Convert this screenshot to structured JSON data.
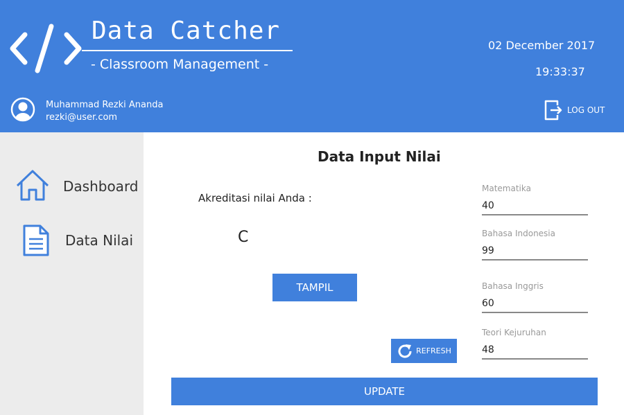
{
  "header": {
    "app_title": "Data Catcher",
    "app_subtitle": "- Classroom Management -",
    "date": "02 December 2017",
    "time": "19:33:37",
    "user_name": "Muhammad Rezki Ananda",
    "user_email": "rezki@user.com",
    "logout_label": "LOG OUT",
    "background_color": "#4080dc"
  },
  "sidebar": {
    "items": [
      {
        "label": "Dashboard",
        "icon": "home-icon"
      },
      {
        "label": "Data Nilai",
        "icon": "document-icon"
      }
    ]
  },
  "main": {
    "title": "Data Input Nilai",
    "akreditasi_label": "Akreditasi nilai Anda :",
    "grade": "C",
    "tampil_label": "TAMPIL",
    "refresh_label": "REFRESH",
    "update_label": "UPDATE",
    "fields": [
      {
        "label": "Matematika",
        "value": "40"
      },
      {
        "label": "Bahasa Indonesia",
        "value": "99"
      },
      {
        "label": "Bahasa Inggris",
        "value": "60"
      },
      {
        "label": "Teori Kejuruhan",
        "value": "48"
      }
    ]
  }
}
